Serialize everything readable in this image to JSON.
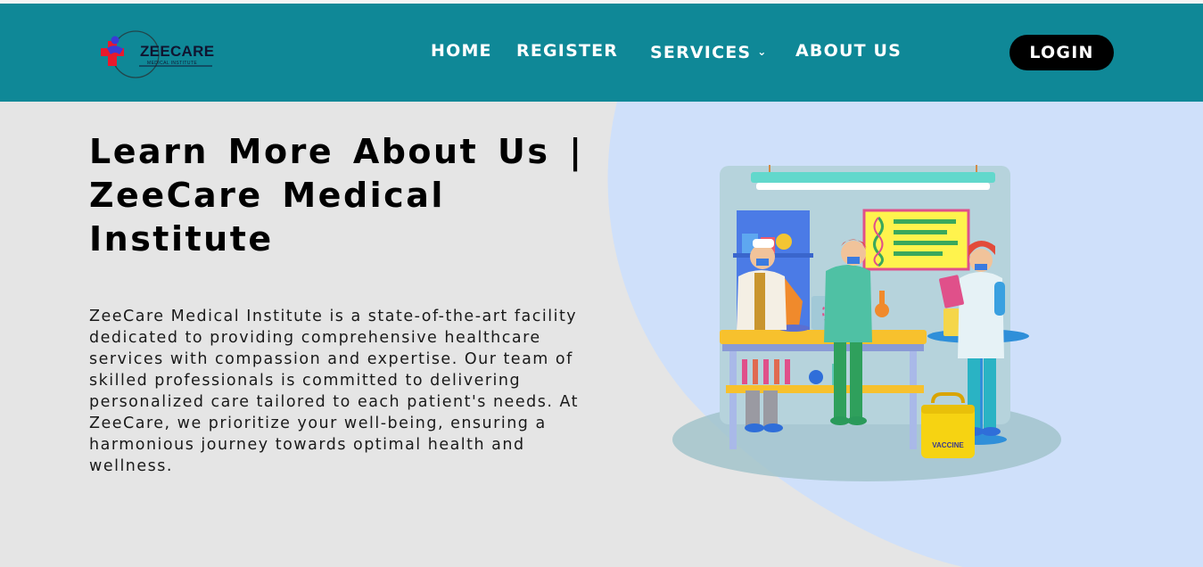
{
  "brand": {
    "name": "ZEECARE",
    "tagline": "MEDICAL INSTITUTE",
    "colors": {
      "navbar": "#0f8897",
      "login_button": "#000000",
      "hero_background": "#e5e5e5",
      "hero_blob": "#cfe0fa",
      "logo_cross": "#e8192c",
      "logo_figure": "#3b3bd6"
    }
  },
  "nav": {
    "items": [
      {
        "label": "HOME"
      },
      {
        "label": "REGISTER"
      },
      {
        "label": "SERVICES",
        "icon": "chevron-down-icon"
      },
      {
        "label": "ABOUT US"
      }
    ],
    "login_label": "LOGIN"
  },
  "hero": {
    "title": "Learn More About Us | ZeeCare Medical Institute",
    "description": "ZeeCare Medical Institute is a state-of-the-art facility dedicated to providing comprehensive healthcare services with compassion and expertise. Our team of skilled professionals is committed to delivering personalized care tailored to each patient's needs. At ZeeCare, we prioritize your well-being, ensuring a harmonious journey towards optimal health and wellness.",
    "illustration": {
      "icon": "medical-lab-illustration",
      "case_label": "VACCINE"
    }
  }
}
